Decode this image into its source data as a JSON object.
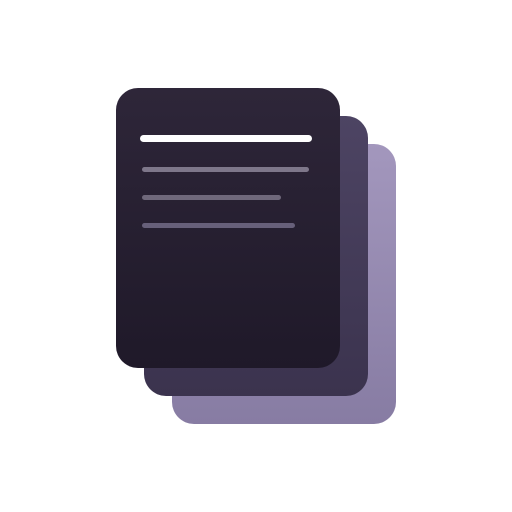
{
  "icon": {
    "name": "stacked-documents-icon",
    "colors": {
      "back_sheet": "#9a8fb5",
      "middle_sheet": "#443b58",
      "front_sheet": "#282131",
      "title_line": "#ffffff",
      "text_line": "#766f84",
      "background": "#ffffff"
    }
  }
}
